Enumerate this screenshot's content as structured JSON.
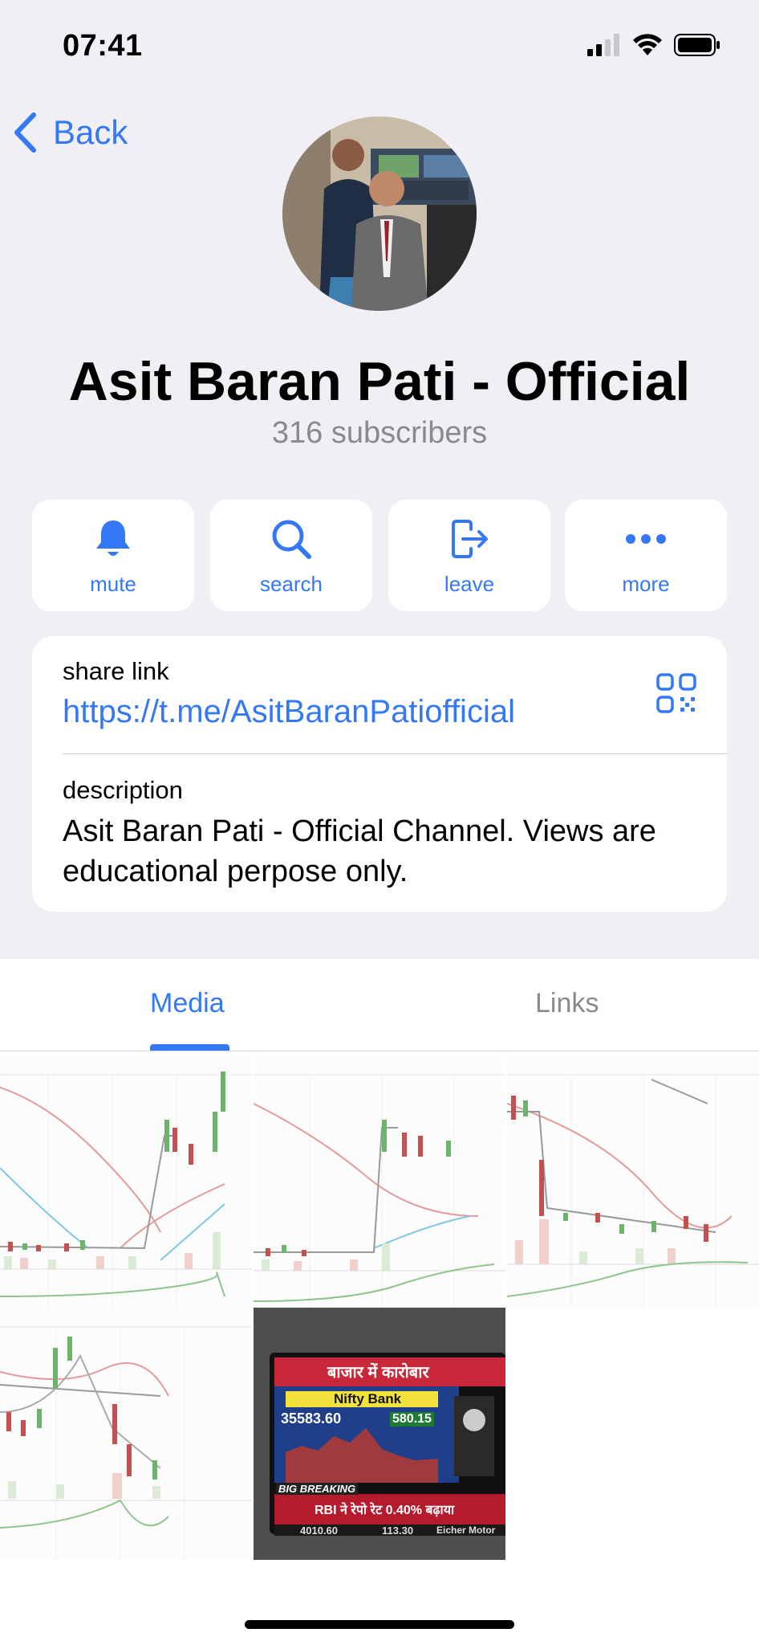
{
  "status_bar": {
    "time": "07:41",
    "icons": [
      "cellular-signal-icon",
      "wifi-icon",
      "battery-icon"
    ]
  },
  "nav": {
    "back_label": "Back"
  },
  "channel": {
    "title": "Asit Baran Pati - Official",
    "subscribers": "316 subscribers"
  },
  "actions": [
    {
      "label": "mute",
      "icon": "bell-icon"
    },
    {
      "label": "search",
      "icon": "search-icon"
    },
    {
      "label": "leave",
      "icon": "leave-icon"
    },
    {
      "label": "more",
      "icon": "more-icon"
    }
  ],
  "info": {
    "share_link_caption": "share link",
    "share_link": "https://t.me/AsitBaranPatiofficial",
    "description_caption": "description",
    "description": "Asit Baran Pati - Official Channel. Views are educational perpose only."
  },
  "tabs": [
    {
      "label": "Media",
      "selected": true
    },
    {
      "label": "Links",
      "selected": false
    }
  ],
  "media": {
    "tv_thumbnail": {
      "header": "बाजार में कारोबार",
      "index_name": "Nifty Bank",
      "index_value": "35583.60",
      "index_change": "580.15",
      "banner": "BIG BREAKING",
      "headline": "RBI ने रेपो रेट 0.40% बढ़ाया",
      "ticker_value": "4010.60",
      "ticker_change": "113.30",
      "ticker_name": "Eicher Motor"
    }
  },
  "colors": {
    "accent": "#3478f6",
    "background": "#efeff4",
    "secondary_text": "#8a8a8e"
  }
}
